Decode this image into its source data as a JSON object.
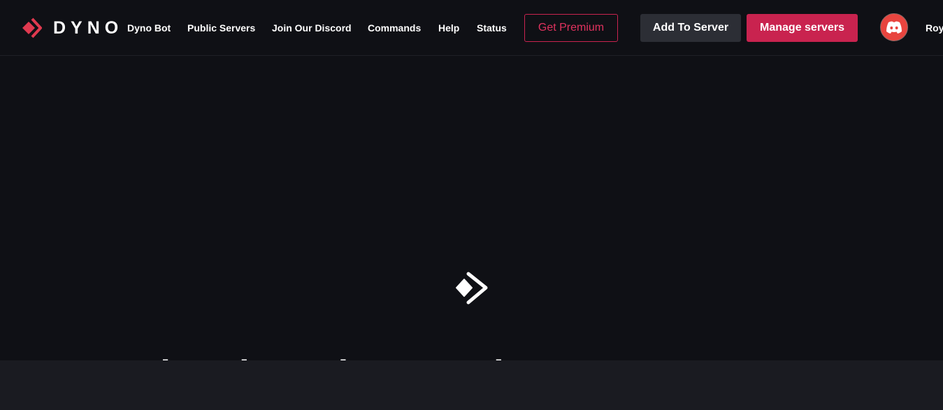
{
  "brand": {
    "name": "DYNO",
    "accent": "#e0394f"
  },
  "nav": {
    "links": [
      "Dyno Bot",
      "Public Servers",
      "Join Our Discord",
      "Commands",
      "Help",
      "Status"
    ]
  },
  "buttons": {
    "premium": "Get Premium",
    "add": "Add To Server",
    "manage": "Manage servers"
  },
  "user": {
    "name": "Roy",
    "avatar_icon": "discord-icon"
  },
  "hero": {
    "heading": "The Discord Bot to elevate your server"
  }
}
